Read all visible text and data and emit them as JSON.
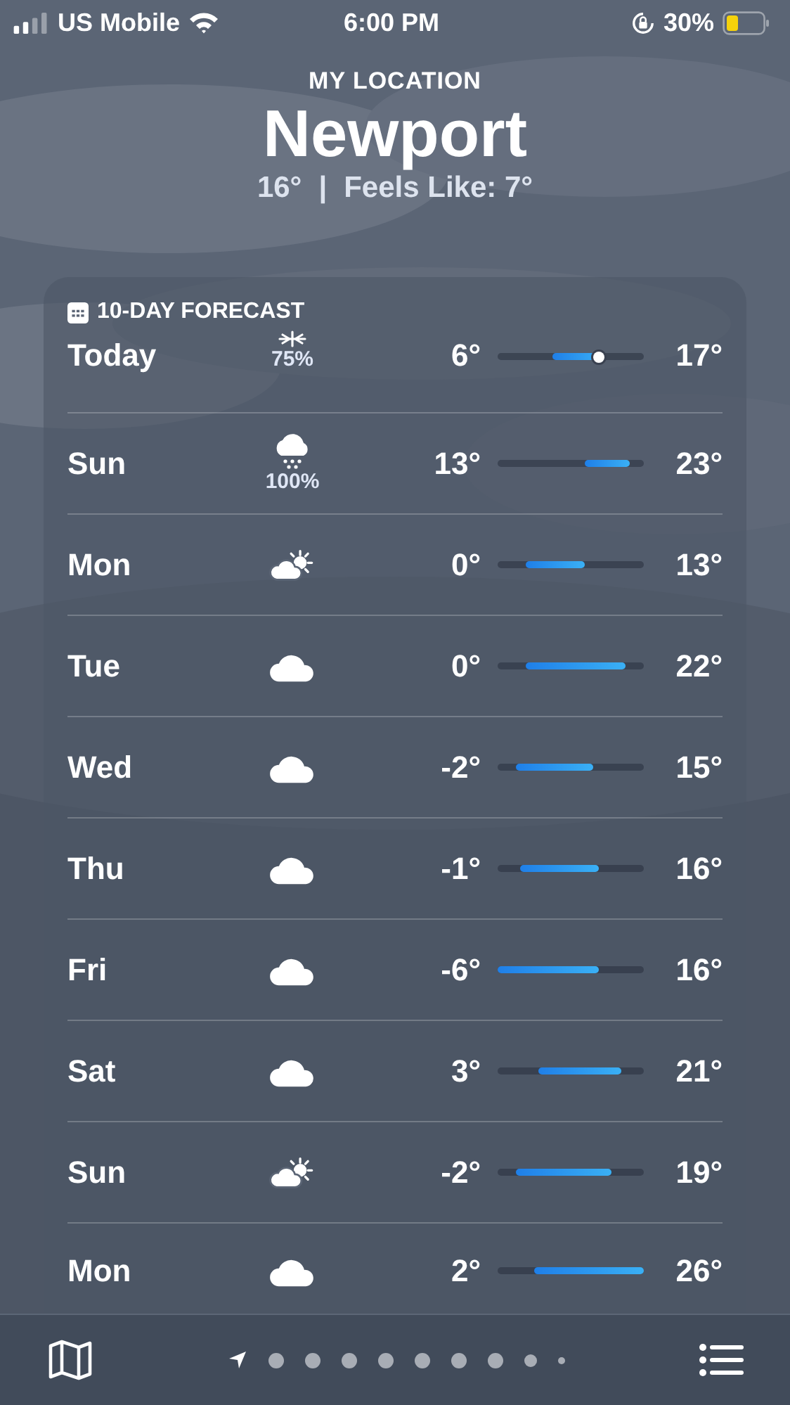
{
  "status_bar": {
    "carrier": "US Mobile",
    "time": "6:00 PM",
    "battery": "30%"
  },
  "header": {
    "subtitle": "MY LOCATION",
    "city": "Newport",
    "current": "16°",
    "separator": "|",
    "feels_like": "Feels Like: 7°"
  },
  "forecast": {
    "title": "10-DAY FORECAST",
    "days": [
      {
        "day": "Today",
        "kind": "snow",
        "precip": "75%",
        "low": "6°",
        "high": "17°",
        "current_marker": true
      },
      {
        "day": "Sun",
        "kind": "cloud-snow",
        "precip": "100%",
        "low": "13°",
        "high": "23°",
        "current_marker": false
      },
      {
        "day": "Mon",
        "kind": "sun-cloud",
        "low": "0°",
        "high": "13°",
        "current_marker": false
      },
      {
        "day": "Tue",
        "kind": "cloud",
        "low": "0°",
        "high": "22°",
        "current_marker": false
      },
      {
        "day": "Wed",
        "kind": "cloud",
        "low": "-2°",
        "high": "15°",
        "current_marker": false
      },
      {
        "day": "Thu",
        "kind": "cloud",
        "low": "-1°",
        "high": "16°",
        "current_marker": false
      },
      {
        "day": "Fri",
        "kind": "cloud",
        "low": "-6°",
        "high": "16°",
        "current_marker": false
      },
      {
        "day": "Sat",
        "kind": "cloud",
        "low": "3°",
        "high": "21°",
        "current_marker": false
      },
      {
        "day": "Sun",
        "kind": "sun-cloud",
        "low": "-2°",
        "high": "19°",
        "current_marker": false
      },
      {
        "day": "Mon",
        "kind": "cloud",
        "low": "2°",
        "high": "26°",
        "current_marker": false
      }
    ]
  }
}
